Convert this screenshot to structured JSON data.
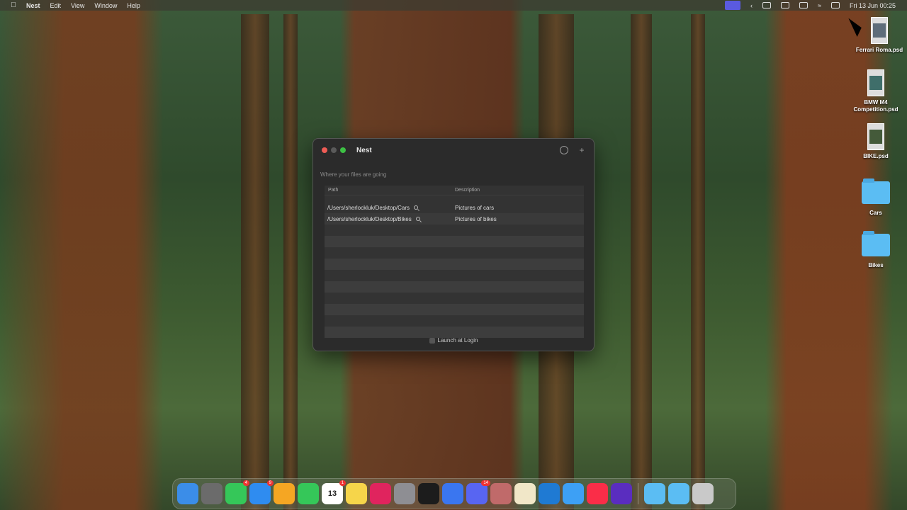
{
  "menubar": {
    "app_name": "Nest",
    "menus": [
      "Edit",
      "View",
      "Window",
      "Help"
    ],
    "clock": "Fri 13 Jun  00:25"
  },
  "desktop": {
    "files": [
      {
        "label": "Ferrari Roma.psd",
        "type": "image"
      },
      {
        "label": "BMW M4 Competition.psd",
        "type": "image"
      },
      {
        "label": "BIKE.psd",
        "type": "image"
      },
      {
        "label": "Cars",
        "type": "folder"
      },
      {
        "label": "Bikes",
        "type": "folder"
      }
    ]
  },
  "window": {
    "title": "Nest",
    "subtitle": "Where your files are going",
    "columns": {
      "path": "Path",
      "description": "Description"
    },
    "rows": [
      {
        "path": "/Users/sherlockluk/Desktop/Cars",
        "description": "Pictures of cars"
      },
      {
        "path": "/Users/sherlockluk/Desktop/Bikes",
        "description": "Pictures of bikes"
      }
    ],
    "launch_at_login_label": "Launch at Login"
  },
  "dock": {
    "apps": [
      {
        "name": "finder",
        "color": "#3b8de8"
      },
      {
        "name": "launchpad",
        "color": "#6b6b6b"
      },
      {
        "name": "messages",
        "color": "#35c759",
        "badge": "4"
      },
      {
        "name": "mail",
        "color": "#2f8cf0",
        "badge": "9"
      },
      {
        "name": "photos",
        "color": "#f5a623"
      },
      {
        "name": "facetime",
        "color": "#35c759"
      },
      {
        "name": "calendar",
        "color": "#ffffff",
        "badge": "1",
        "text": "13"
      },
      {
        "name": "notes",
        "color": "#f6d54a"
      },
      {
        "name": "focus",
        "color": "#e0245e"
      },
      {
        "name": "system-settings",
        "color": "#8e8e93"
      },
      {
        "name": "terminal",
        "color": "#1c1c1c"
      },
      {
        "name": "signal",
        "color": "#3a76f0"
      },
      {
        "name": "discord",
        "color": "#5865f2",
        "badge": "14"
      },
      {
        "name": "xcode-app",
        "color": "#c06a6a"
      },
      {
        "name": "coffee-app",
        "color": "#f1e7c8"
      },
      {
        "name": "vscode",
        "color": "#1f7ad3"
      },
      {
        "name": "xcode",
        "color": "#3da0f5"
      },
      {
        "name": "music",
        "color": "#fa2d48"
      },
      {
        "name": "arc",
        "color": "#5a2dbf"
      }
    ],
    "right_items": [
      {
        "name": "downloads-folder",
        "color": "#5bbdf3"
      },
      {
        "name": "applications-folder",
        "color": "#5bbdf3"
      },
      {
        "name": "trash",
        "color": "#c9c9c9"
      }
    ]
  }
}
